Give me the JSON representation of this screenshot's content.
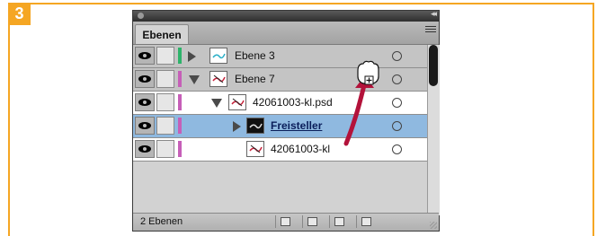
{
  "step": {
    "number": "3"
  },
  "panel": {
    "tab_label": "Ebenen",
    "rows": [
      {
        "label": "Ebene 3",
        "kind": "group",
        "expanded": false,
        "color": "#2db36a"
      },
      {
        "label": "Ebene 7",
        "kind": "group",
        "expanded": true,
        "color": "#c65fb8"
      },
      {
        "label": "42061003-kl.psd",
        "kind": "file",
        "expanded": true,
        "color": "#c65fb8"
      },
      {
        "label": "Freisteller",
        "kind": "file",
        "expanded": false,
        "selected": true,
        "color": "#c65fb8"
      },
      {
        "label": "42061003-kl",
        "kind": "file",
        "expanded": false,
        "color": "#c65fb8"
      }
    ],
    "status_text": "2 Ebenen",
    "icons": {
      "visibility": "eye-icon",
      "lock": "lock-toggle-icon",
      "target": "target-circle-icon",
      "menu": "panel-menu-icon",
      "clipping_mask": "clipping-mask-icon",
      "new_sublayer": "new-sublayer-icon",
      "new_layer": "new-layer-icon",
      "delete": "trash-icon",
      "cursor": "grab-hand-cursor-icon"
    },
    "accent_colors": {
      "selection": "#8fb9e0",
      "arrow": "#b3123a",
      "frame": "#f5a623"
    }
  }
}
